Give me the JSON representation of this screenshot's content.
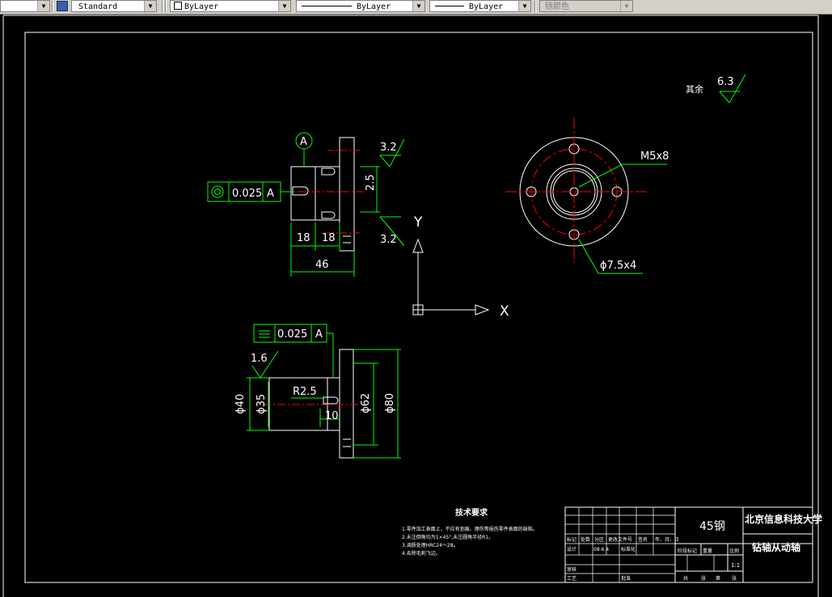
{
  "toolbar": {
    "text_style": "Standard",
    "layer": "ByLayer",
    "linetype": "ByLayer",
    "lineweight": "ByLayer",
    "plot_style": "随颜色"
  },
  "drawing": {
    "datum_label": "A",
    "fcf_top": {
      "tolerance": "0.025",
      "datum": "A"
    },
    "fcf_bottom": {
      "tolerance": "0.025",
      "datum": "A"
    },
    "roughness_top": "3.2",
    "roughness_mid": "3.2",
    "roughness_left": "1.6",
    "roughness_other": "6.3",
    "roughness_other_label": "其余",
    "dim_2_5": "2.5",
    "dim_18a": "18",
    "dim_18b": "18",
    "dim_46": "46",
    "hole_thread": "M5x8",
    "hole_bolt": "ϕ7.5x4",
    "dim_phi40": "ϕ40",
    "dim_phi35": "ϕ35",
    "dim_r25": "R2.5",
    "dim_10": "10",
    "dim_phi62": "ϕ62",
    "dim_phi80": "ϕ80",
    "ucs_x": "X",
    "ucs_y": "Y"
  },
  "notes": {
    "title": "技术要求",
    "lines": [
      "1.零件加工表面上，不应有划痕、擦伤等损伤零件表面的缺陷。",
      "2.未注倒角均为1×45°,未注圆角半径R1。",
      "3.调质处理HRC24～28。",
      "4.去除毛刺飞边。"
    ]
  },
  "title_block": {
    "material": "45钢",
    "school": "北京信息科技大学",
    "part_name": "钻轴从动轴",
    "scale": "1:1",
    "labels": [
      "标记",
      "处数",
      "分区",
      "更改文件号",
      "签名",
      "年、月、日",
      "设计",
      "标准化",
      "审核",
      "工艺",
      "批准",
      "阶段标记",
      "重量",
      "比例",
      "共",
      "张",
      "第",
      "张"
    ],
    "date": "08.6.4"
  }
}
